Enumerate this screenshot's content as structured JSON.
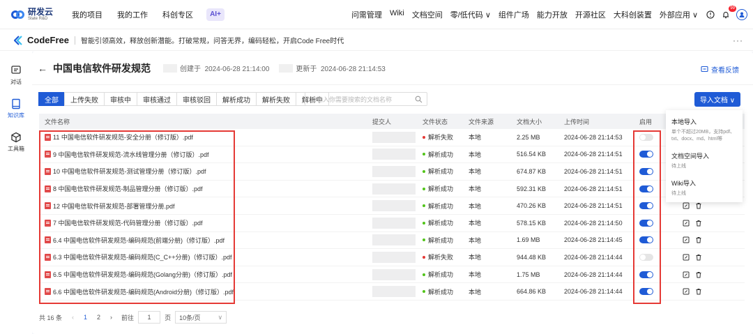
{
  "brand": {
    "name_cn": "研发云",
    "name_en": "State R&D"
  },
  "topnav": [
    "我的项目",
    "我的工作",
    "科创专区"
  ],
  "ai_badge": "AI+",
  "rightnav": [
    "问需管理",
    "Wiki",
    "文档空间",
    "零/低代码 ∨",
    "组件广场",
    "能力开放",
    "开源社区",
    "大科创装置",
    "外部应用 ∨"
  ],
  "notif_count": "99",
  "codefree": {
    "name": "CodeFree",
    "slogan": "智能引领高效，释放创新潜能。打破常规，问答无界，编码轻松，开启Code Free时代"
  },
  "sidebar": [
    {
      "label": "对话",
      "icon": "chat-icon"
    },
    {
      "label": "知识库",
      "icon": "knowledge-icon"
    },
    {
      "label": "工具箱",
      "icon": "toolbox-icon"
    }
  ],
  "header": {
    "title": "中国电信软件研发规范",
    "created_label": "创建于",
    "created": "2024-06-28 21:14:00",
    "updated_label": "更新于",
    "updated": "2024-06-28 21:14:53",
    "feedback": "查看反馈"
  },
  "tabs": [
    "全部",
    "上传失败",
    "审核中",
    "审核通过",
    "审核驳回",
    "解析成功",
    "解析失败",
    "解析中"
  ],
  "search_placeholder": "请输入你需要搜索的文档名称",
  "import_button": "导入文档 ∨",
  "columns": [
    "文件名称",
    "提交人",
    "文件状态",
    "文件来源",
    "文档大小",
    "上传时间",
    "启用"
  ],
  "rows": [
    {
      "name": "11 中国电信软件研发规范-安全分册（修订版）.pdf",
      "status": "解析失败",
      "ok": false,
      "source": "本地",
      "size": "2.25 MB",
      "time": "2024-06-28 21:14:53",
      "enabled": false
    },
    {
      "name": "9 中国电信软件研发规范-流水线管理分册（修订版）.pdf",
      "status": "解析成功",
      "ok": true,
      "source": "本地",
      "size": "516.54 KB",
      "time": "2024-06-28 21:14:51",
      "enabled": true
    },
    {
      "name": "10 中国电信软件研发规范-测试管理分册（修订版）.pdf",
      "status": "解析成功",
      "ok": true,
      "source": "本地",
      "size": "674.87 KB",
      "time": "2024-06-28 21:14:51",
      "enabled": true
    },
    {
      "name": "8 中国电信软件研发规范-制品管理分册（修订版）.pdf",
      "status": "解析成功",
      "ok": true,
      "source": "本地",
      "size": "592.31 KB",
      "time": "2024-06-28 21:14:51",
      "enabled": true
    },
    {
      "name": "12 中国电信软件研发规范-部署管理分册.pdf",
      "status": "解析成功",
      "ok": true,
      "source": "本地",
      "size": "470.26 KB",
      "time": "2024-06-28 21:14:51",
      "enabled": true
    },
    {
      "name": "7 中国电信软件研发规范-代码管理分册（修订版）.pdf",
      "status": "解析成功",
      "ok": true,
      "source": "本地",
      "size": "578.15 KB",
      "time": "2024-06-28 21:14:50",
      "enabled": true
    },
    {
      "name": "6.4 中国电信软件研发规范-编码规范(前端分册)（修订版）.pdf",
      "status": "解析成功",
      "ok": true,
      "source": "本地",
      "size": "1.69 MB",
      "time": "2024-06-28 21:14:45",
      "enabled": true
    },
    {
      "name": "6.3 中国电信软件研发规范-编码规范(C_C++分册)（修订版）.pdf",
      "status": "解析失败",
      "ok": false,
      "source": "本地",
      "size": "944.48 KB",
      "time": "2024-06-28 21:14:44",
      "enabled": false
    },
    {
      "name": "6.5 中国电信软件研发规范-编码规范(Golang分册)（修订版）.pdf",
      "status": "解析成功",
      "ok": true,
      "source": "本地",
      "size": "1.75 MB",
      "time": "2024-06-28 21:14:44",
      "enabled": true
    },
    {
      "name": "6.6 中国电信软件研发规范-编码规范(Android分册)（修订版）.pdf",
      "status": "解析成功",
      "ok": true,
      "source": "本地",
      "size": "664.86 KB",
      "time": "2024-06-28 21:14:44",
      "enabled": true
    }
  ],
  "dropdown": [
    {
      "title": "本地导入",
      "desc": "单个不超过20MB，支持pdf、txt、docx、md、html等"
    },
    {
      "title": "文档空间导入",
      "desc": "待上线"
    },
    {
      "title": "Wiki导入",
      "desc": "待上线"
    }
  ],
  "pager": {
    "total": "共 16 条",
    "pages": [
      "1",
      "2"
    ],
    "goto_label": "前往",
    "goto_value": "1",
    "page_unit": "页",
    "page_size": "10条/页"
  },
  "colors": {
    "primary": "#1f5bd6",
    "danger": "#e53935",
    "success": "#52c41a"
  }
}
